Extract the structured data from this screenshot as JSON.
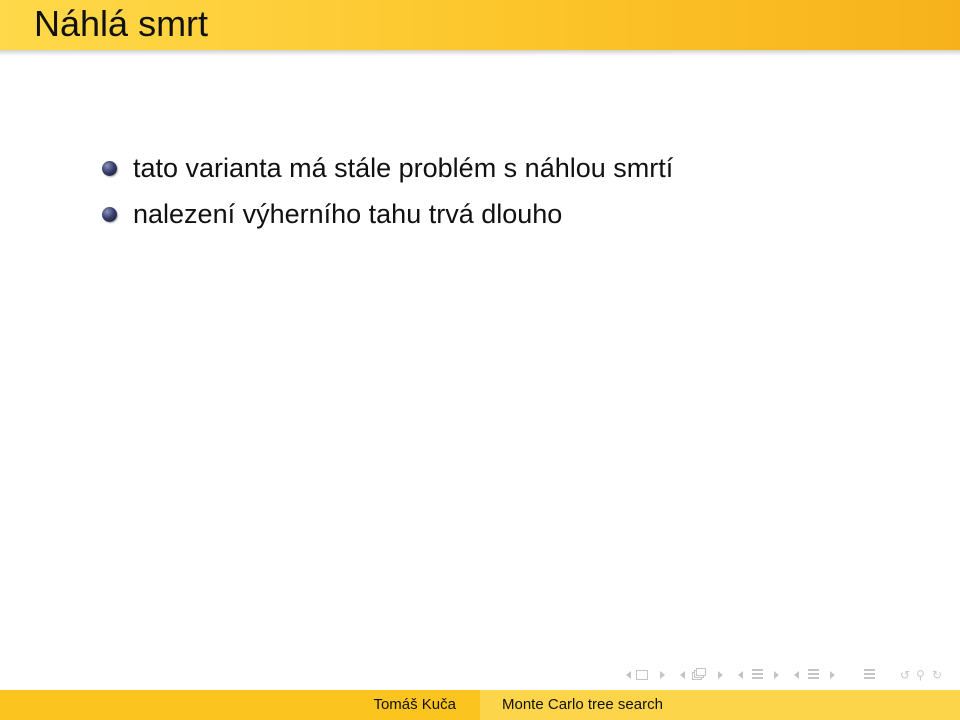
{
  "slide": {
    "title": "Náhlá smrt",
    "items": [
      {
        "text": "tato varianta má stále problém s náhlou smrtí"
      },
      {
        "text": "nalezení výherního tahu trvá dlouho"
      }
    ]
  },
  "footer": {
    "author": "Tomáš Kuča",
    "presentation_title": "Monte Carlo tree search"
  },
  "navigation": {
    "icons": [
      "previous-slide-arrow-icon",
      "slide-frame-icon",
      "next-slide-arrow-icon",
      "previous-subsection-arrow-icon",
      "subsection-icon",
      "next-subsection-arrow-icon",
      "previous-section-arrow-icon",
      "section-icon",
      "next-section-arrow-icon",
      "previous-document-arrow-icon",
      "document-icon",
      "next-document-arrow-icon",
      "appendix-icon",
      "back-icon",
      "search-icon",
      "forward-search-icon"
    ],
    "color": "#c4c4c4"
  },
  "colors": {
    "title_bar": "#fcc52a",
    "footer_left": "#fcc41f",
    "footer_right": "#fdd54a",
    "bullet": "#3a4170"
  }
}
